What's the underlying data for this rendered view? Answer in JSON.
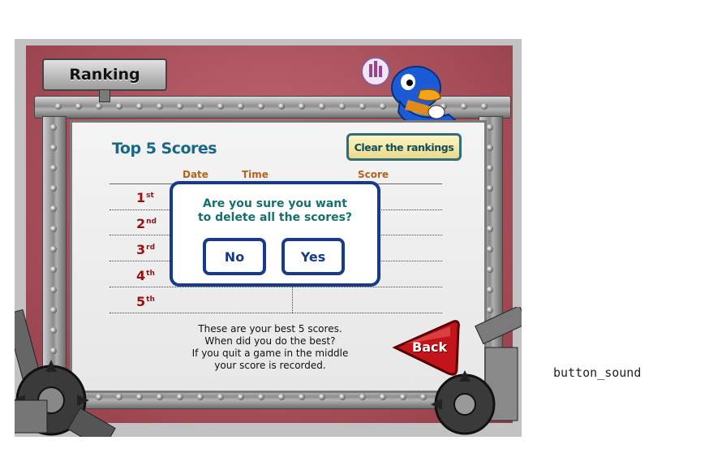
{
  "header": {
    "sign_label": "Ranking"
  },
  "panel": {
    "title": "Top 5 Scores",
    "clear_button": "Clear the rankings",
    "columns": [
      "Date",
      "Time",
      "Score"
    ],
    "ranks": [
      {
        "num": "1",
        "suffix": "st"
      },
      {
        "num": "2",
        "suffix": "nd"
      },
      {
        "num": "3",
        "suffix": "rd"
      },
      {
        "num": "4",
        "suffix": "th"
      },
      {
        "num": "5",
        "suffix": "th"
      }
    ],
    "note": [
      "These are your best 5 scores.",
      "When did you do the best?",
      "If you quit a game in the middle",
      "your score is recorded."
    ],
    "back_button": "Back"
  },
  "dialog": {
    "line1": "Are you sure you want",
    "line2": "to delete all the scores?",
    "no_label": "No",
    "yes_label": "Yes"
  },
  "outside": {
    "sound_label": "button_sound"
  },
  "colors": {
    "backdrop": "#a84f5a",
    "dialog_border": "#163b8c",
    "title": "#17688a",
    "rank": "#9a1010",
    "back_button": "#c4141b"
  }
}
